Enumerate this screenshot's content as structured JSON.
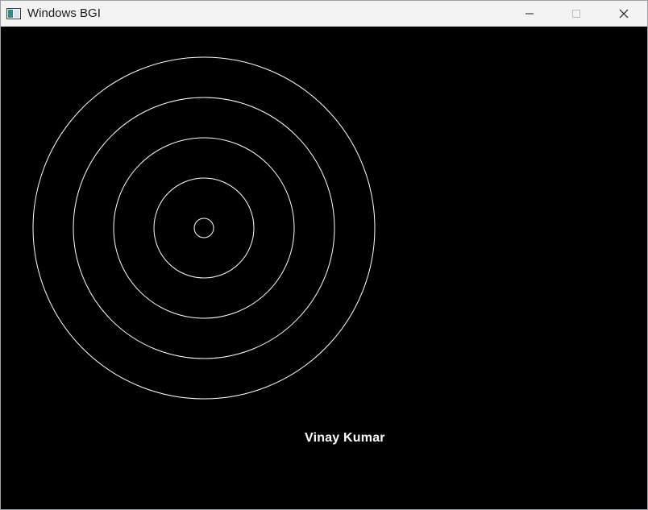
{
  "window": {
    "title": "Windows BGI",
    "controls": {
      "minimize": "minimize-icon",
      "maximize": "maximize-icon",
      "close": "close-icon"
    }
  },
  "canvas": {
    "background": "#000000",
    "stroke": "#ffffff",
    "label": "Vinay Kumar",
    "circle_count": 5
  }
}
